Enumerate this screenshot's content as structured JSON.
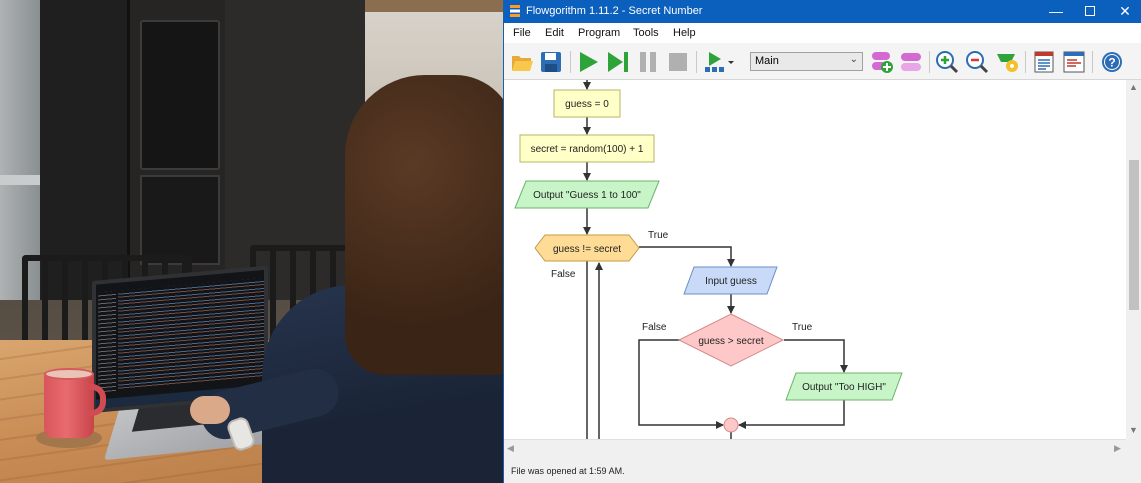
{
  "window": {
    "title": "Flowgorithm 1.11.2 - Secret Number",
    "minimize_label": "—",
    "close_label": "✕"
  },
  "menu": [
    "File",
    "Edit",
    "Program",
    "Tools",
    "Help"
  ],
  "toolbar": {
    "function_select_value": "Main",
    "icons": [
      "open-folder-icon",
      "save-icon",
      "run-icon",
      "step-icon",
      "pause-icon",
      "stop-icon",
      "run-speed-icon",
      "add-function-icon",
      "remove-function-icon",
      "zoom-in-icon",
      "zoom-out-icon",
      "layout-icon",
      "source-code-icon",
      "console-icon",
      "help-icon"
    ]
  },
  "flowchart": {
    "assign1": "guess = 0",
    "assign2": "secret = random(100) + 1",
    "output1": "Output \"Guess 1 to 100\"",
    "loop_condition": "guess != secret",
    "loop_true": "True",
    "loop_false": "False",
    "input1": "Input guess",
    "if_condition": "guess > secret",
    "if_true": "True",
    "if_false": "False",
    "output2": "Output \"Too HIGH\""
  },
  "colors": {
    "titlebar": "#0b5fbd",
    "assign_fill": "#ffffc8",
    "output_fill": "#c8f5c8",
    "loop_fill": "#ffdc96",
    "input_fill": "#c8daf7",
    "if_fill": "#ffc8c8"
  },
  "status": {
    "message": "File was opened at 1:59 AM."
  }
}
